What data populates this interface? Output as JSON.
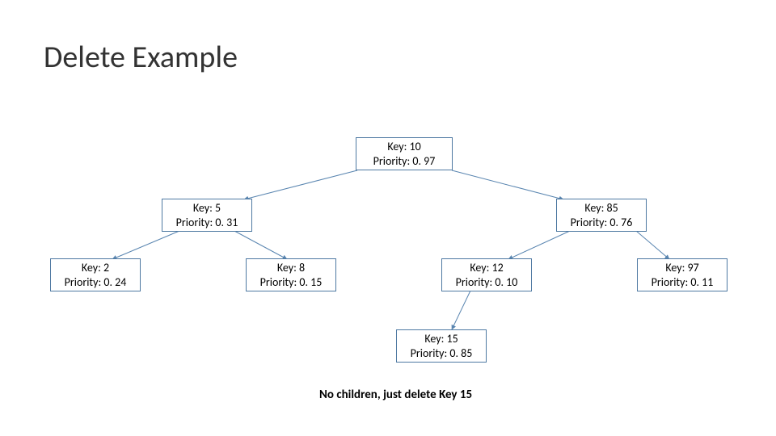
{
  "title": "Delete Example",
  "nodes": {
    "root": {
      "key_line": "Key: 10",
      "prio_line": "Priority: 0. 97"
    },
    "n5": {
      "key_line": "Key: 5",
      "prio_line": "Priority: 0. 31"
    },
    "n85": {
      "key_line": "Key: 85",
      "prio_line": "Priority: 0. 76"
    },
    "n2": {
      "key_line": "Key: 2",
      "prio_line": "Priority: 0. 24"
    },
    "n8": {
      "key_line": "Key: 8",
      "prio_line": "Priority: 0. 15"
    },
    "n12": {
      "key_line": "Key: 12",
      "prio_line": "Priority: 0. 10"
    },
    "n97": {
      "key_line": "Key: 97",
      "prio_line": "Priority: 0. 11"
    },
    "n15": {
      "key_line": "Key: 15",
      "prio_line": "Priority: 0. 85"
    }
  },
  "caption": "No children, just delete Key 15"
}
